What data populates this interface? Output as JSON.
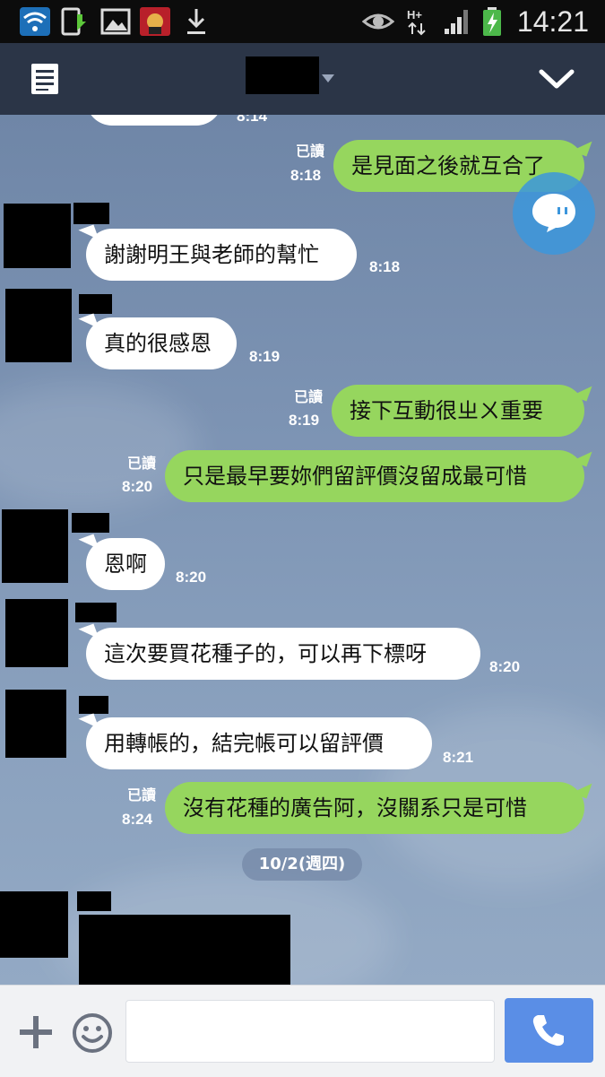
{
  "status_bar": {
    "time": "14:21",
    "icons": [
      "wifi-icon",
      "phone-update-icon",
      "gallery-icon",
      "app-icon",
      "download-icon",
      "eye-icon",
      "network-hplus-icon",
      "signal-icon",
      "battery-charging-icon"
    ]
  },
  "header": {
    "menu_icon": "list-icon",
    "title_redacted": true,
    "dropdown_icon": "caret-down-icon",
    "collapse_icon": "chevron-down-icon"
  },
  "messages": [
    {
      "dir": "out",
      "text": "是見面之後就互合了",
      "read": "已讀",
      "time": "8:18"
    },
    {
      "dir": "in",
      "text": "謝謝明王與老師的幫忙",
      "time": "8:18"
    },
    {
      "dir": "in",
      "text": "真的很感恩",
      "time": "8:19"
    },
    {
      "dir": "out",
      "text": "接下互動很ㄓㄨ重要",
      "read": "已讀",
      "time": "8:19"
    },
    {
      "dir": "out",
      "text": "只是最早要妳們留評價沒留成最可惜",
      "read": "已讀",
      "time": "8:20"
    },
    {
      "dir": "in",
      "text": "恩啊",
      "time": "8:20"
    },
    {
      "dir": "in",
      "text": "這次要買花種子的，可以再下標呀",
      "time": "8:20"
    },
    {
      "dir": "in",
      "text": "用轉帳的，結完帳可以留評價",
      "time": "8:21"
    },
    {
      "dir": "out",
      "text": "沒有花種的廣告阿，沒關系只是可惜",
      "read": "已讀",
      "time": "8:24"
    }
  ],
  "date_divider": "10/2(週四)",
  "input_bar": {
    "plus_icon": "plus-icon",
    "emoji_icon": "smiley-icon",
    "input_value": "",
    "call_icon": "phone-icon"
  },
  "colors": {
    "header": "#2b3547",
    "outgoing": "#96d65e",
    "incoming": "#ffffff",
    "call_button": "#5a8ee6"
  }
}
